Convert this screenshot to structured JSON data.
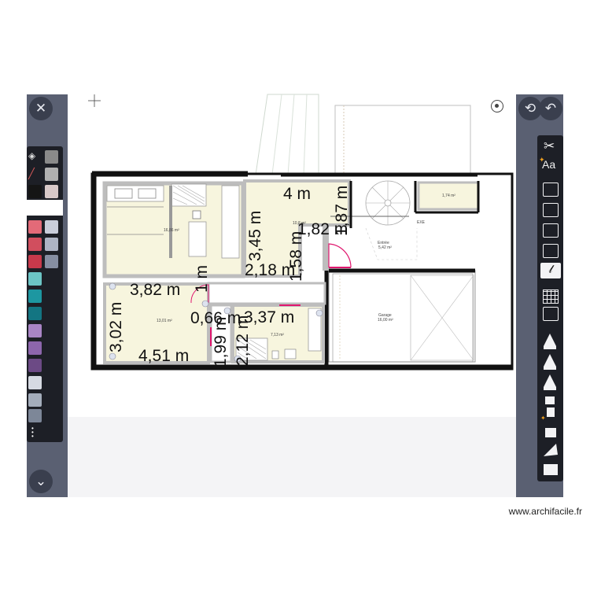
{
  "left_toolbar": {
    "close_icon": "close-icon",
    "collapse_icon": "chevron-down-icon",
    "swatches": [
      {
        "color": "#8a8a8a"
      },
      {
        "color": "#b0b0b0"
      },
      {
        "color": "#d8c9c9"
      },
      {
        "color": "#d3d3d3"
      },
      {
        "color": "#151515"
      },
      {
        "color": "#e6dbdb"
      },
      {
        "color": "#e36a78"
      },
      {
        "color": "#c9cdda"
      },
      {
        "color": "#d14e5e"
      },
      {
        "color": "#aeb4c4"
      },
      {
        "color": "#c8394b"
      },
      {
        "color": "#868ea2"
      },
      {
        "color": "#6cc5c5"
      },
      {
        "color": "#1d97a1"
      },
      {
        "color": "#137582"
      },
      {
        "color": "#a985c5"
      },
      {
        "color": "#8d66ac"
      },
      {
        "color": "#6c4a85"
      },
      {
        "color": "#d6dae2"
      },
      {
        "color": "#a4adbb"
      },
      {
        "color": "#7d8798"
      }
    ]
  },
  "right_toolbar": {
    "undo_icon": "undo-icon",
    "text_tool_label": "Aa"
  },
  "canvas": {
    "rooms": [
      {
        "area": "16,86 m²"
      },
      {
        "area": "10,8 m²"
      },
      {
        "area": "1,74 m²"
      },
      {
        "name": "Entrée",
        "area": "5,42 m²"
      },
      {
        "area": "13,01 m²"
      },
      {
        "area": "7,13 m²"
      },
      {
        "name": "Garage",
        "area": "16,00 m²"
      }
    ],
    "small_labels": {
      "ex": "EXE"
    },
    "dimensions": {
      "d1": "4 m",
      "d2": "3,45 m",
      "d3": "1,87 m",
      "d4": "1,82 m",
      "d5": "1,58 m",
      "d6": "2,18 m",
      "d7": "3,82 m",
      "d8": "1 m",
      "d9": "3,02 m",
      "d10": "0,66 m",
      "d11": "3,37 m",
      "d12": "1,99 m",
      "d13": "2,12 m",
      "d14": "4,51 m"
    }
  },
  "watermark": "www.archifacile.fr"
}
